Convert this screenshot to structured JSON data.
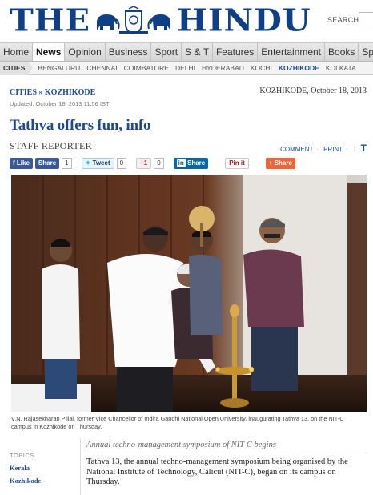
{
  "masthead": {
    "logo_left": "THE",
    "logo_right": "HINDU",
    "search_label": "SEARCH"
  },
  "main_nav": {
    "items": [
      "Home",
      "News",
      "Opinion",
      "Business",
      "Sport",
      "S & T",
      "Features",
      "Entertainment",
      "Books",
      "Spec"
    ],
    "active": "News"
  },
  "cities_bar": {
    "label": "CITIES",
    "items": [
      "BENGALURU",
      "CHENNAI",
      "COIMBATORE",
      "DELHI",
      "HYDERABAD",
      "KOCHI",
      "KOZHIKODE",
      "KOLKATA"
    ],
    "active": "KOZHIKODE"
  },
  "article": {
    "breadcrumb": "CITIES » KOZHIKODE",
    "updated": "Updated: October 18, 2013 11:56 IST",
    "dateline": "KOZHIKODE, October 18, 2013",
    "headline": "Tathva offers fun, info",
    "byline": "STAFF REPORTER",
    "tools": {
      "comment": "COMMENT",
      "print": "PRINT",
      "t_small": "T",
      "t_big": "T"
    },
    "share": {
      "fb_like": "Like",
      "fb_share": "Share",
      "fb_count": "1",
      "tweet": "Tweet",
      "tweet_count": "0",
      "gplus": "+1",
      "gplus_count": "0",
      "linkedin": "Share",
      "pinterest": "Pin it",
      "share": "Share"
    },
    "caption": "V.N. Rajasekharan Pillai, former Vice Chancellor of Indira Gandhi National Open University, inaugurating Tathva 13, on the NIT-C campus in Kozhikode on Thursday.",
    "subhead": "Annual techno-management symposium of NIT-C begins",
    "body": "Tathva 13, the annual techno-management symposium being organised by the National Institute of Technology, Calicut (NIT-C), began on its campus on Thursday.",
    "topics": {
      "label": "TOPICS",
      "items": [
        "Kerala",
        "Kozhikode"
      ]
    }
  },
  "colors": {
    "brand_blue": "#1b4b8e",
    "masthead_blue": "#0f3f85",
    "facebook": "#3b5998",
    "linkedin": "#0a66a4"
  }
}
